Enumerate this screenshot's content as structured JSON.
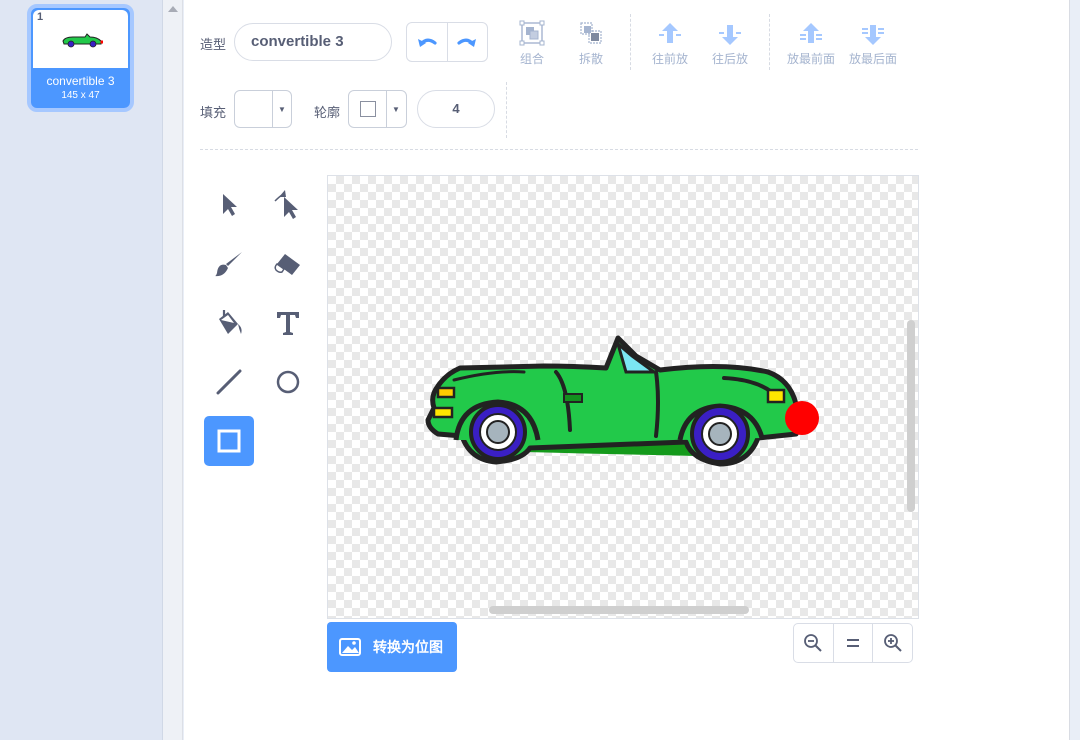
{
  "costume_list": {
    "costume": {
      "number": "1",
      "name": "convertible 3",
      "size": "145 x 47"
    }
  },
  "toolbar": {
    "name_label": "造型",
    "costume_name": "convertible 3",
    "group_label": "组合",
    "ungroup_label": "拆散",
    "forward_label": "往前放",
    "backward_label": "往后放",
    "front_label": "放最前面",
    "back_label": "放最后面",
    "fill_label": "填充",
    "outline_label": "轮廓",
    "stroke_width": "4"
  },
  "tools": [
    "select",
    "reshape",
    "brush",
    "eraser",
    "fill",
    "text",
    "line",
    "circle",
    "rectangle"
  ],
  "active_tool": "rectangle",
  "canvas": {
    "convert_button_label": "转换为位图"
  },
  "colors": {
    "accent": "#4c97ff",
    "car_body": "#22c94a",
    "car_shadow": "#149a1b",
    "outline": "#222222",
    "wheel": "#3a1fc4",
    "nose": "#ff0000"
  }
}
